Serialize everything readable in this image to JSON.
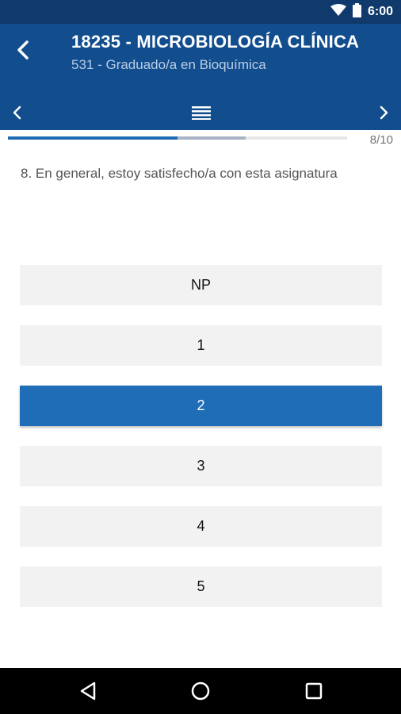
{
  "status_bar": {
    "time": "6:00",
    "icons": [
      "wifi-icon",
      "battery-icon"
    ]
  },
  "header": {
    "course_title": "18235 - MICROBIOLOGÍA CLÍNICA",
    "course_subtitle": "531 - Graduado/a en Bioquímica",
    "icons": [
      "back-arrow-icon",
      "chevron-left-icon",
      "menu-icon",
      "chevron-right-icon"
    ]
  },
  "progress": {
    "label": "8/10",
    "current": 8,
    "total": 10,
    "fill_fraction": 0.5,
    "secondary_fill_fraction": 0.7
  },
  "question": {
    "text": "8. En general, estoy satisfecho/a con esta asignatura"
  },
  "options": [
    {
      "label": "NP",
      "selected": false
    },
    {
      "label": "1",
      "selected": false
    },
    {
      "label": "2",
      "selected": true
    },
    {
      "label": "3",
      "selected": false
    },
    {
      "label": "4",
      "selected": false
    },
    {
      "label": "5",
      "selected": false
    }
  ],
  "system_nav": {
    "icons": [
      "back-triangle-icon",
      "home-circle-icon",
      "recents-square-icon"
    ]
  },
  "colors": {
    "status_bar": "#0f3a6b",
    "app_bar": "#124d8e",
    "accent": "#1e6db6",
    "option_bg": "#f2f2f2"
  }
}
